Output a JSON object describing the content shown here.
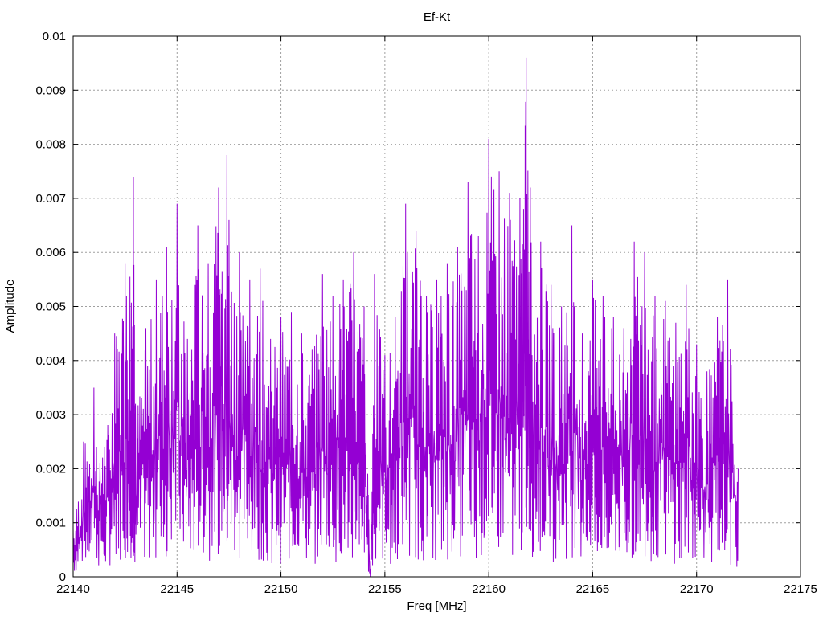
{
  "chart_data": {
    "type": "line",
    "title": "Ef-Kt",
    "xlabel": "Freq [MHz]",
    "ylabel": "Amplitude",
    "xlim": [
      22140,
      22175
    ],
    "ylim": [
      0,
      0.01
    ],
    "x_ticks": [
      22140,
      22145,
      22150,
      22155,
      22160,
      22165,
      22170,
      22175
    ],
    "y_ticks": [
      0,
      0.001,
      0.002,
      0.003,
      0.004,
      0.005,
      0.006,
      0.007,
      0.008,
      0.009,
      0.01
    ],
    "x_tick_labels": [
      "22140",
      "22145",
      "22150",
      "22155",
      "22160",
      "22165",
      "22170",
      "22175"
    ],
    "y_tick_labels": [
      "0",
      "0.001",
      "0.002",
      "0.003",
      "0.004",
      "0.005",
      "0.006",
      "0.007",
      "0.008",
      "0.009",
      "0.01"
    ],
    "grid": true,
    "series": [
      {
        "color": "#9400d3",
        "x": [
          22140.0,
          22140.5,
          22141.0,
          22141.5,
          22142.0,
          22142.5,
          22142.9,
          22143.0,
          22143.5,
          22144.0,
          22144.5,
          22145.0,
          22145.5,
          22146.0,
          22146.5,
          22147.0,
          22147.4,
          22147.5,
          22148.0,
          22148.5,
          22149.0,
          22149.5,
          22150.0,
          22150.5,
          22151.0,
          22151.5,
          22152.0,
          22152.5,
          22153.0,
          22153.5,
          22154.0,
          22154.3,
          22154.5,
          22155.0,
          22155.5,
          22156.0,
          22156.5,
          22157.0,
          22157.5,
          22158.0,
          22158.5,
          22159.0,
          22159.5,
          22160.0,
          22160.5,
          22161.0,
          22161.5,
          22161.8,
          22162.0,
          22162.5,
          22163.0,
          22163.5,
          22164.0,
          22164.5,
          22165.0,
          22165.5,
          22166.0,
          22166.5,
          22167.0,
          22167.5,
          22168.0,
          22168.5,
          22169.0,
          22169.5,
          22170.0,
          22170.5,
          22171.0,
          22171.5,
          22172.0
        ],
        "y": [
          0.0009,
          0.0025,
          0.0035,
          0.0024,
          0.0045,
          0.0058,
          0.0074,
          0.0032,
          0.0046,
          0.0055,
          0.0061,
          0.0069,
          0.0044,
          0.0065,
          0.0058,
          0.0072,
          0.0078,
          0.0066,
          0.006,
          0.0055,
          0.0057,
          0.0044,
          0.0048,
          0.0049,
          0.0045,
          0.0042,
          0.0056,
          0.0052,
          0.0055,
          0.006,
          0.005,
          0.0,
          0.0056,
          0.0041,
          0.0048,
          0.0069,
          0.0064,
          0.0052,
          0.0055,
          0.0058,
          0.0061,
          0.0073,
          0.0063,
          0.0081,
          0.0075,
          0.0071,
          0.007,
          0.0096,
          0.0072,
          0.0062,
          0.0054,
          0.005,
          0.0065,
          0.0045,
          0.0055,
          0.0052,
          0.0048,
          0.0046,
          0.0062,
          0.006,
          0.0052,
          0.0051,
          0.0047,
          0.0054,
          0.0043,
          0.0038,
          0.0048,
          0.0055,
          0.002
        ]
      }
    ]
  }
}
